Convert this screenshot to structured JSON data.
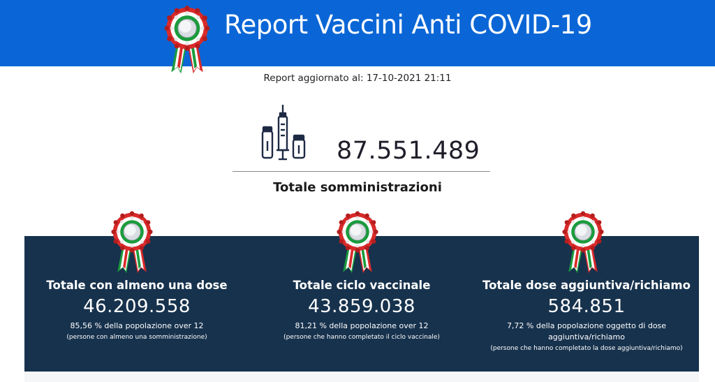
{
  "header": {
    "title": "Report Vaccini Anti COVID-19",
    "background_color": "#0a66d6",
    "emblem": "italian-cockade-rosette-icon"
  },
  "report": {
    "updated_label": "Report aggiornato al: 17-10-2021 21:11"
  },
  "total": {
    "icon": "vaccine-vials-syringe-icon",
    "value": "87.551.489",
    "label": "Totale somministrazioni"
  },
  "panel": {
    "background_color": "#17324d",
    "stats": [
      {
        "title": "Totale con almeno una dose",
        "value": "46.209.558",
        "percentage_text": "85,56 % della popolazione over 12",
        "note": "(persone con almeno una somministrazione)"
      },
      {
        "title": "Totale ciclo vaccinale",
        "value": "43.859.038",
        "percentage_text": "81,21 % della popolazione over 12",
        "note": "(persone che hanno completato il ciclo vaccinale)"
      },
      {
        "title": "Totale dose aggiuntiva/richiamo",
        "value": "584.851",
        "percentage_text": "7,72 % della popolazione oggetto di dose aggiuntiva/richiamo",
        "note": "(persone che hanno completato la dose aggiuntiva/richiamo)"
      }
    ]
  }
}
